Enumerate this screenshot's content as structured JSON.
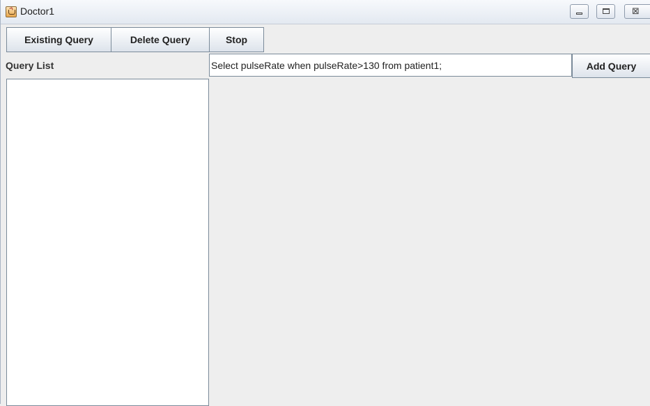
{
  "window": {
    "title": "Doctor1"
  },
  "toolbar": {
    "existing_query_label": "Existing Query",
    "delete_query_label": "Delete Query",
    "stop_label": "Stop"
  },
  "query_panel": {
    "label": "Query List",
    "items": []
  },
  "query_editor": {
    "value": "Select pulseRate when pulseRate>130 from patient1;",
    "add_label": "Add Query"
  },
  "colors": {
    "background": "#eeeeee",
    "border": "#7a8a99",
    "list_background": "#ffffff"
  },
  "icons": {
    "app": "java-cup-icon",
    "minimize": "minimize-icon",
    "maximize": "maximize-icon",
    "close": "close-icon"
  }
}
